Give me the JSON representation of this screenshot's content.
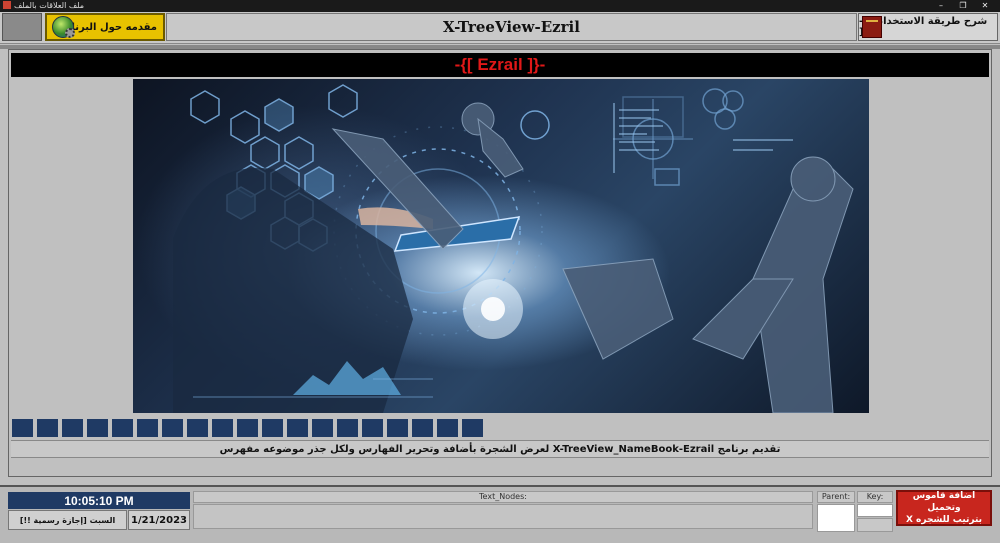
{
  "window": {
    "title": "ملف العلاقات بالملف",
    "controls": [
      "–",
      "❐",
      "✕"
    ]
  },
  "header": {
    "about_label": "مقدمه حول البرنامج",
    "app_title": "X-TreeView-Ezril",
    "howto_label": "-[[ شرح طريقة الاستخدام ]]-"
  },
  "main": {
    "banner_title": "-{[ Ezrail ]}-",
    "block_count": 19,
    "description": "تقديم برنامج X-TreeView_NameBook-Ezrail لعرض الشجرة بأضافة وتحرير الفهارس ولكل جذر موضوعه مفهرس"
  },
  "status": {
    "time": "10:05:10 PM",
    "date": "1/21/2023",
    "day": "السبت [إجازة رسمية !!]"
  },
  "fields": {
    "nodes_label": "Text_Nodes:",
    "parent_label": "Parent:",
    "key_label": "Key:"
  },
  "buttons": {
    "add_line1": "اضافة قاموس وتحميل",
    "add_line2": "بترتيب للشجره X"
  },
  "colors": {
    "accent_navy": "#1f3a64",
    "title_red": "#e01818",
    "about_yellow": "#e8c200",
    "add_red": "#c8261e"
  }
}
